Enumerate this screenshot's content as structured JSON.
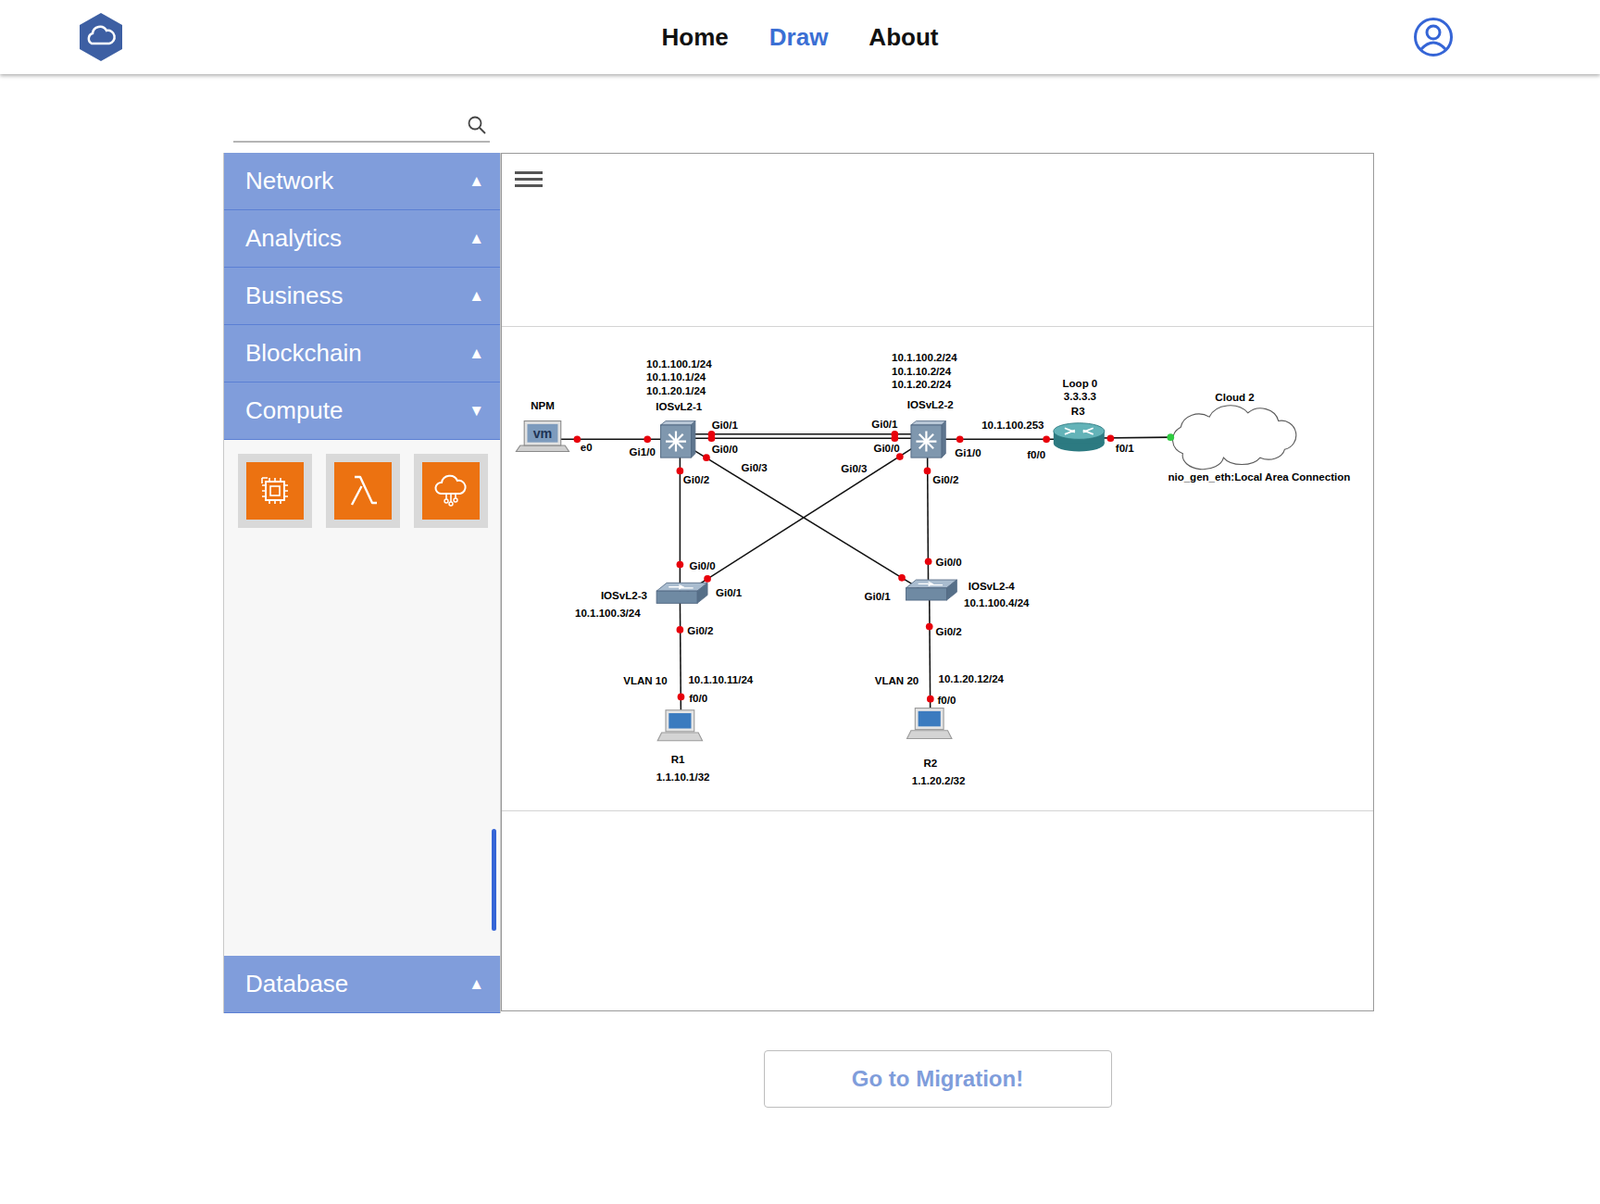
{
  "header": {
    "nav": [
      {
        "label": "Home",
        "selected": false
      },
      {
        "label": "Draw",
        "selected": true
      },
      {
        "label": "About",
        "selected": false
      }
    ]
  },
  "sidebar": {
    "sections": [
      {
        "label": "Network",
        "arrow": "▲",
        "expanded": false,
        "items": []
      },
      {
        "label": "Analytics",
        "arrow": "▲",
        "expanded": false,
        "items": []
      },
      {
        "label": "Business",
        "arrow": "▲",
        "expanded": false,
        "items": []
      },
      {
        "label": "Blockchain",
        "arrow": "▲",
        "expanded": false,
        "items": []
      },
      {
        "label": "Compute",
        "arrow": "▼",
        "expanded": true,
        "items": [
          {
            "kind": "server"
          },
          {
            "kind": "lambda"
          },
          {
            "kind": "iot"
          }
        ]
      },
      {
        "label": "Database",
        "arrow": "▲",
        "expanded": false,
        "items": []
      }
    ],
    "scrollbar": {
      "level": 0.94
    }
  },
  "diagram": {
    "nodes": [
      {
        "name": "NPM",
        "kind": "vm",
        "icon_text": "vm",
        "details": []
      },
      {
        "name": "IOSvL2-1",
        "kind": "l3switch",
        "details": [
          "10.1.100.1/24",
          "10.1.10.1/24",
          "10.1.20.1/24"
        ]
      },
      {
        "name": "IOSvL2-2",
        "kind": "l3switch",
        "details": [
          "10.1.100.2/24",
          "10.1.10.2/24",
          "10.1.20.2/24"
        ]
      },
      {
        "name": "R3",
        "kind": "router",
        "details": [
          "Loop 0",
          "3.3.3.3"
        ]
      },
      {
        "name": "Cloud 2",
        "kind": "cloud",
        "details": [
          "nio_gen_eth:Local Area Connection"
        ]
      },
      {
        "name": "IOSvL2-3",
        "kind": "switch",
        "details": [
          "10.1.100.3/24"
        ]
      },
      {
        "name": "IOSvL2-4",
        "kind": "switch",
        "details": [
          "10.1.100.4/24"
        ]
      },
      {
        "name": "R1",
        "kind": "pc",
        "details": [
          "1.1.10.1/32"
        ]
      },
      {
        "name": "R2",
        "kind": "pc",
        "details": [
          "1.1.20.2/32"
        ]
      }
    ],
    "links": [
      {
        "ends": [
          {
            "port": "e0",
            "color": "#e8000b"
          },
          {
            "port": "Gi1/0",
            "color": "#e8000b"
          }
        ],
        "notes": []
      },
      {
        "ends": [
          {
            "port": "Gi0/1",
            "color": "#e8000b"
          },
          {
            "port": "Gi0/1",
            "color": "#e8000b"
          }
        ],
        "notes": []
      },
      {
        "ends": [
          {
            "port": "Gi0/0",
            "color": "#e8000b"
          },
          {
            "port": "Gi0/0",
            "color": "#e8000b"
          }
        ],
        "notes": []
      },
      {
        "ends": [
          {
            "port": "Gi1/0",
            "color": "#e8000b"
          },
          {
            "port": "f0/0",
            "color": "#e8000b"
          }
        ],
        "notes": [
          "10.1.100.253"
        ]
      },
      {
        "ends": [
          {
            "port": "f0/1",
            "color": "#e8000b"
          },
          {
            "color": "#2ecc40"
          }
        ],
        "notes": []
      },
      {
        "ends": [
          {
            "port": "Gi0/2",
            "color": "#e8000b"
          },
          {
            "port": "Gi0/0",
            "color": "#e8000b"
          }
        ],
        "notes": []
      },
      {
        "ends": [
          {
            "port": "Gi0/3",
            "color": "#e8000b"
          },
          {
            "port": "Gi0/1",
            "color": "#e8000b"
          }
        ],
        "notes": []
      },
      {
        "ends": [
          {
            "port": "Gi0/3",
            "color": "#e8000b"
          },
          {
            "port": "Gi0/1",
            "color": "#e8000b"
          }
        ],
        "notes": []
      },
      {
        "ends": [
          {
            "port": "Gi0/2",
            "color": "#e8000b"
          },
          {
            "port": "Gi0/0",
            "color": "#e8000b"
          }
        ],
        "notes": []
      },
      {
        "ends": [
          {
            "port": "Gi0/2",
            "color": "#e8000b"
          },
          {
            "port": "f0/0",
            "color": "#e8000b"
          }
        ],
        "notes": [
          "VLAN 10",
          "10.1.10.11/24"
        ]
      },
      {
        "ends": [
          {
            "port": "Gi0/2",
            "color": "#e8000b"
          },
          {
            "port": "f0/0",
            "color": "#e8000b"
          }
        ],
        "notes": [
          "VLAN 20",
          "10.1.20.12/24"
        ]
      }
    ]
  },
  "migrate_button": "Go to Migration!"
}
